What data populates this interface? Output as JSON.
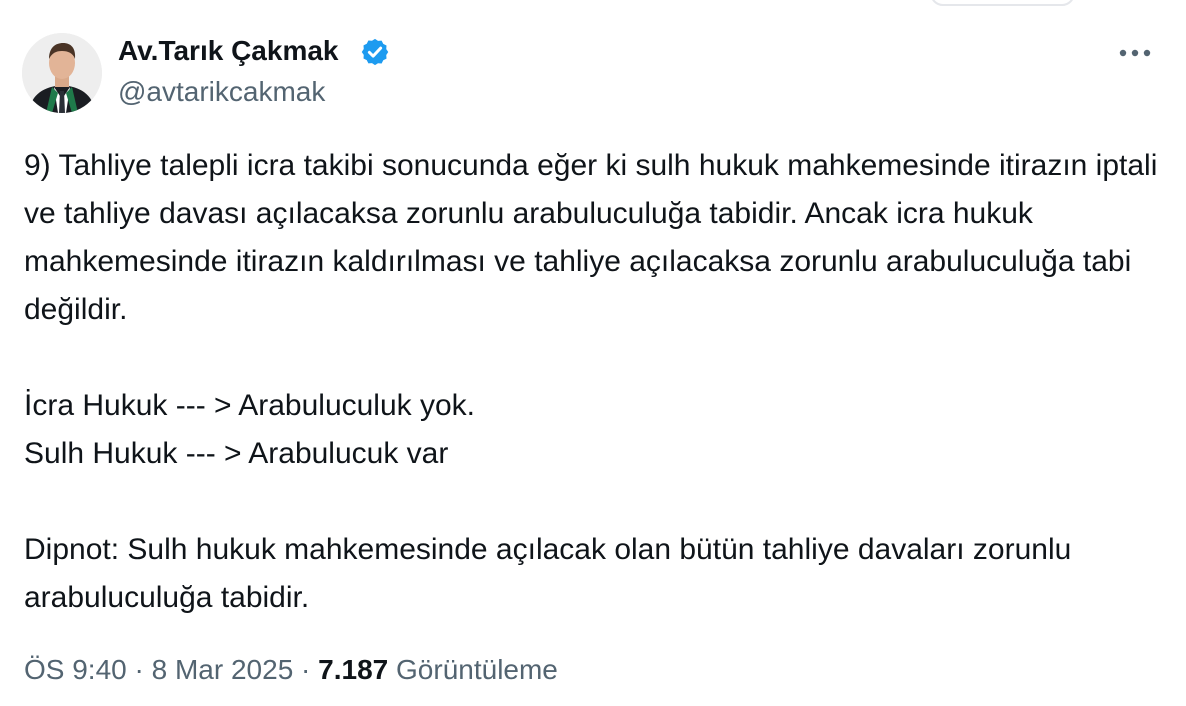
{
  "author": {
    "display_name": "Av.Tarık Çakmak",
    "handle": "@avtarikcakmak",
    "verified_icon": "verified-badge-icon",
    "accent_color": "#1d9bf0"
  },
  "tweet": {
    "paragraph_1": "9) Tahliye talepli icra takibi sonucunda eğer ki sulh hukuk mahkemesinde itirazın iptali ve tahliye davası açılacaksa zorunlu arabuluculuğa tabidir. Ancak icra hukuk mahkemesinde itirazın kaldırılması ve tahliye açılacaksa zorunlu arabuluculuğa tabi değildir.",
    "line_2": "İcra Hukuk --- > Arabuluculuk yok.",
    "line_3": "Sulh Hukuk --- > Arabulucuk var",
    "paragraph_4": "Dipnot: Sulh hukuk mahkemesinde açılacak olan bütün tahliye davaları zorunlu arabuluculuğa tabidir."
  },
  "meta": {
    "time": "ÖS 9:40",
    "separator": "·",
    "date": "8 Mar 2025",
    "views_count": "7.187",
    "views_label": "Görüntüleme"
  },
  "icons": {
    "more": "more-horizontal-icon",
    "avatar": "avatar"
  }
}
